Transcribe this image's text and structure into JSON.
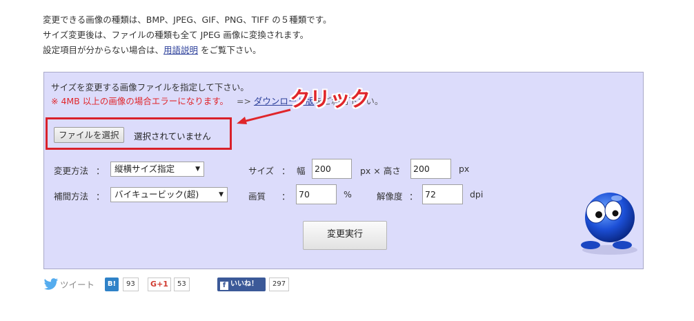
{
  "intro": {
    "line1": "変更できる画像の種類は、BMP、JPEG、GIF、PNG、TIFF の５種類です。",
    "line2": "サイズ変更後は、ファイルの種類も全て JPEG 画像に変換されます。",
    "line3_before": "設定項目が分からない場合は、",
    "line3_link": "用語説明",
    "line3_after": " をご覧下さい。"
  },
  "form": {
    "instruction": "サイズを変更する画像ファイルを指定して下さい。",
    "warning": "※ 4MB 以上の画像の場合エラーになります。",
    "warning_rest_before": "=> ",
    "warning_link": "ダウンロード版",
    "warning_rest_after": "をご利用下さい。",
    "file_button": "ファイルを選択",
    "file_status": "選択されていません",
    "annotation": "クリック",
    "method_label": "変更方法",
    "method_value": "縦横サイズ指定",
    "size_label": "サイズ",
    "width_label": "幅",
    "width_value": "200",
    "height_label": "px × 高さ",
    "height_value": "200",
    "px_unit": "px",
    "interp_label": "補間方法",
    "interp_value": "バイキュービック(超)",
    "quality_label": "画質",
    "quality_value": "70",
    "percent": "%",
    "resolution_label": "解像度",
    "resolution_value": "72",
    "dpi": "dpi",
    "colon": "：",
    "execute_button": "変更実行"
  },
  "share": {
    "tweet": "ツイート",
    "hatena_logo": "B!",
    "hatena_count": "93",
    "gplus_label": "G+1",
    "gplus_count": "53",
    "fb_label": "いいね！",
    "fb_count": "297"
  },
  "colors": {
    "panel_bg": "#dcdcfb",
    "warning": "#e0262b",
    "highlight_border": "#d9202a",
    "link": "#2b3f9a"
  }
}
